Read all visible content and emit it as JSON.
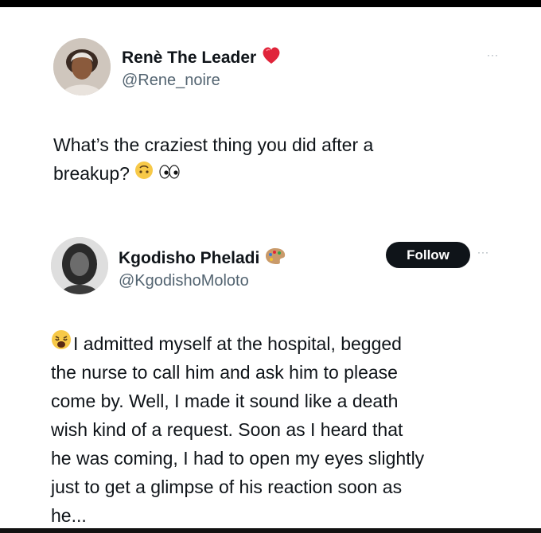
{
  "post1": {
    "author_name": "Renè The Leader",
    "author_badge_icon": "red-heart-icon",
    "handle": "@Rene_noire",
    "more_label": "···",
    "text_line1": "What’s the craziest thing you did after a",
    "text_line2": "breakup?",
    "trailing_icons": [
      "upside-down-face-icon",
      "eyes-icon"
    ]
  },
  "post2": {
    "author_name": "Kgodisho Pheladi",
    "author_badge_icon": "artist-palette-icon",
    "handle": "@KgodishoMoloto",
    "follow_label": "Follow",
    "more_label": "···",
    "leading_icon": "weary-face-icon",
    "lines": [
      "I admitted myself at the hospital, begged",
      "the nurse to call him and ask him to please",
      "come by. Well, I made it sound like a death",
      "wish kind of a request. Soon as I heard that",
      "he was coming, I had to open my eyes slightly",
      "just to get a glimpse of his reaction soon as",
      "he..."
    ]
  },
  "colors": {
    "text": "#0f1419",
    "secondary": "#536471",
    "follow_bg": "#0f1419",
    "heart": "#e0243a",
    "emoji_yellow": "#f7c948"
  }
}
